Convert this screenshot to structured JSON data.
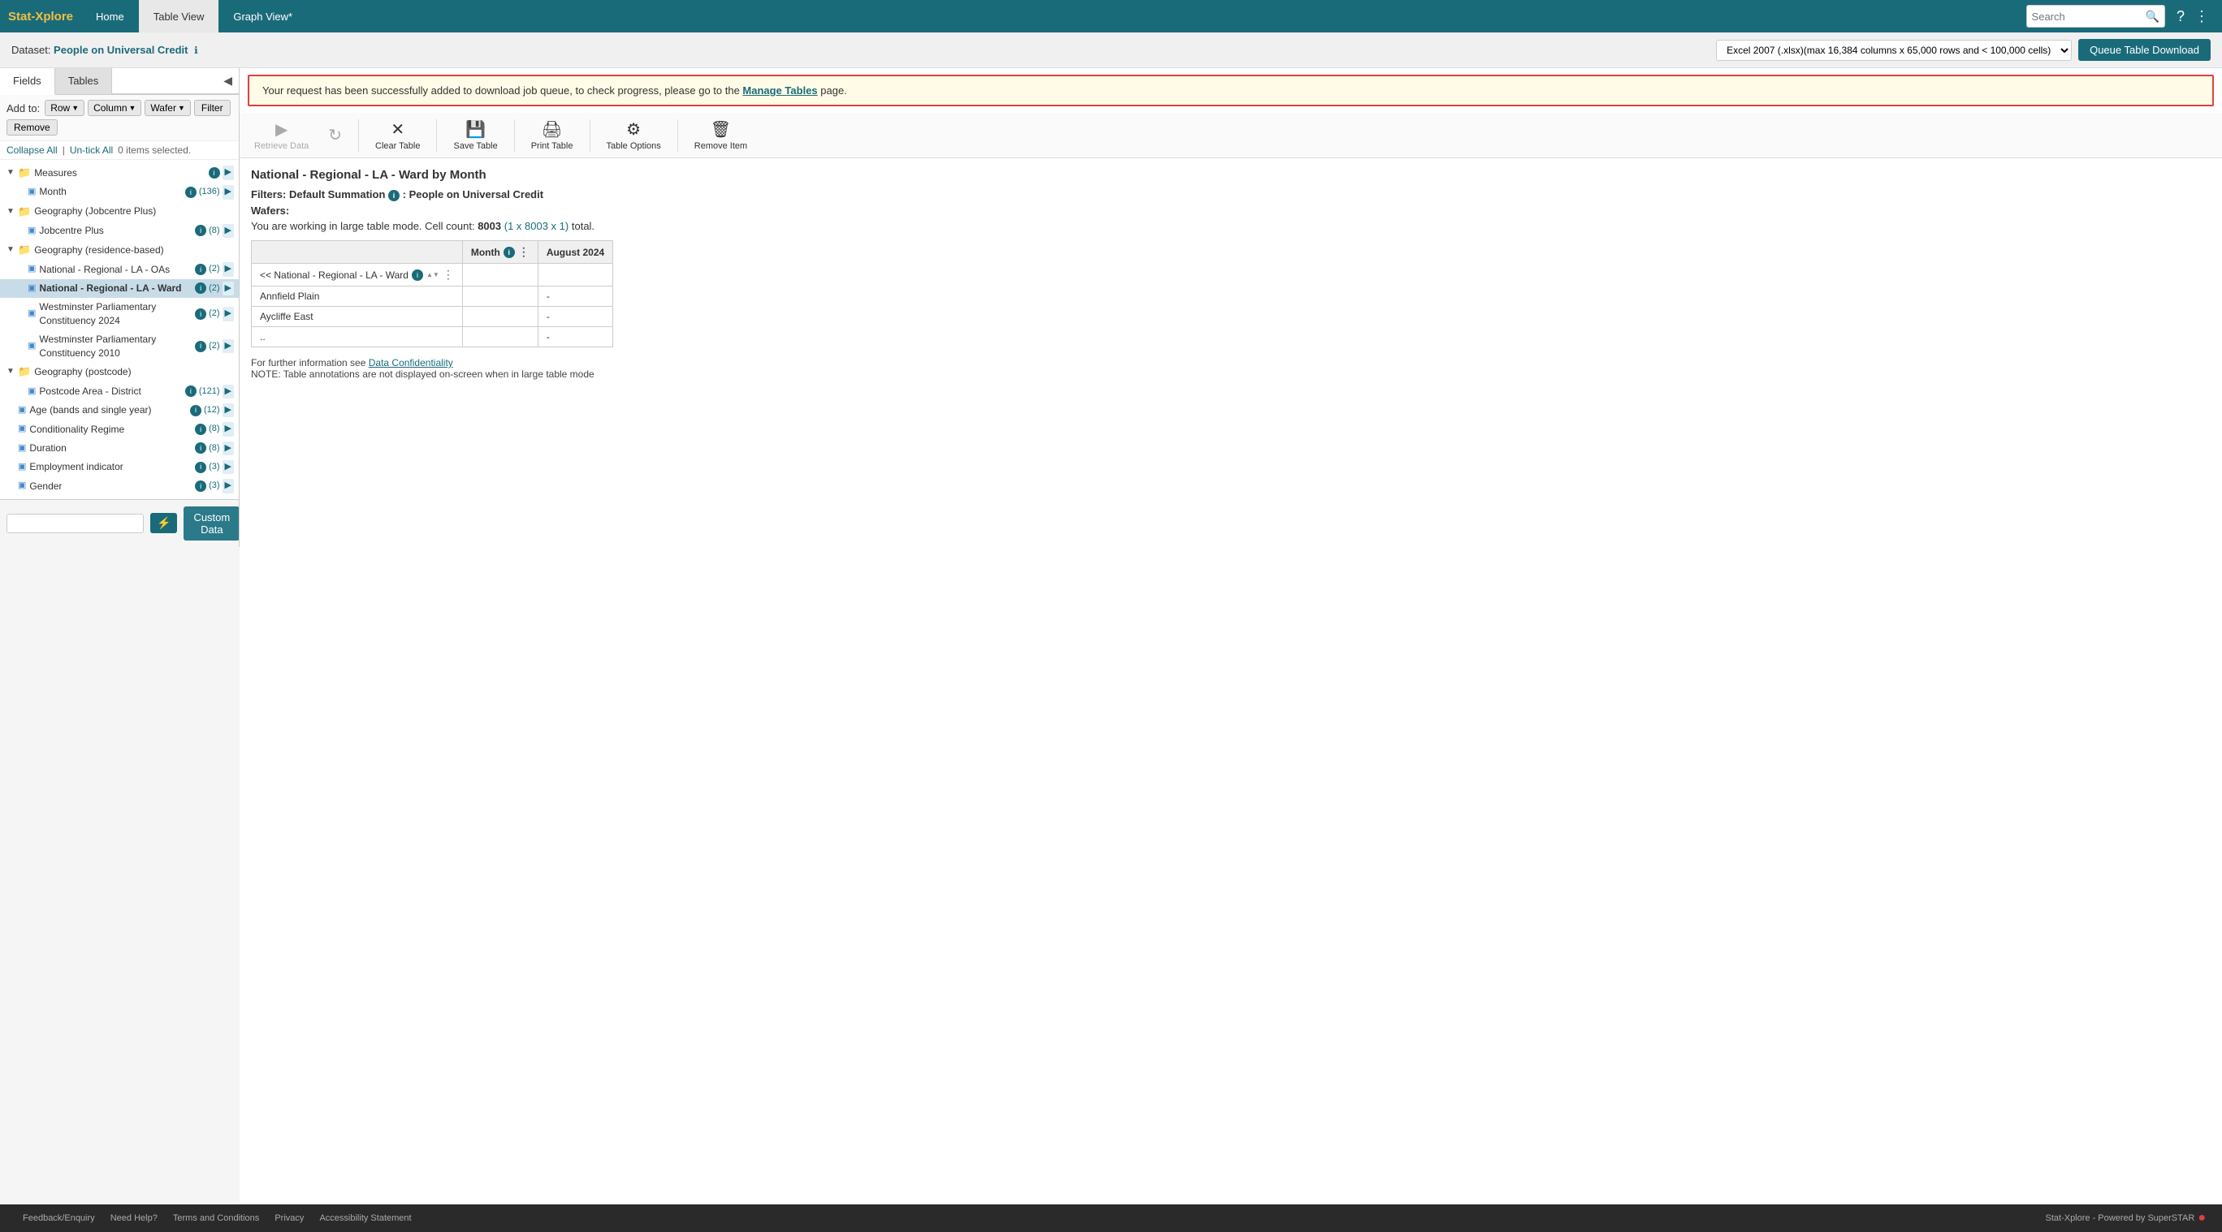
{
  "app": {
    "logo_stat": "Stat",
    "logo_xplore": "-Xplore",
    "nav_home": "Home",
    "nav_table": "Table View",
    "nav_graph": "Graph View*",
    "search_placeholder": "Search",
    "help_icon": "?",
    "menu_icon": "⋮"
  },
  "dataset_bar": {
    "label": "Dataset:",
    "name": "People on Universal Credit",
    "format_options": [
      "Excel 2007 (.xlsx)(max 16,384 columns x 65,000 rows and < 100,000 cells)"
    ],
    "format_selected": "Excel 2007 (.xlsx)(max 16,384 columns x 65,000 rows and < 100,000 cells)",
    "queue_btn": "Queue Table Download"
  },
  "alert": {
    "message_prefix": "Your request has been successfully added to download job queue, to check progress, please go to the ",
    "link_text": "Manage Tables",
    "message_suffix": " page."
  },
  "toolbar": {
    "retrieve_label": "Retrieve Data",
    "clear_label": "Clear Table",
    "save_label": "Save Table",
    "print_label": "Print Table",
    "options_label": "Table Options",
    "remove_label": "Remove Item"
  },
  "sidebar": {
    "tab_fields": "Fields",
    "tab_tables": "Tables",
    "add_to_label": "Add to:",
    "row_btn": "Row",
    "column_btn": "Column",
    "wafer_btn": "Wafer",
    "filter_btn": "Filter",
    "remove_btn": "Remove",
    "collapse_all": "Collapse All",
    "untick_all": "Un-tick All",
    "items_selected": "0 items selected.",
    "tree_items": [
      {
        "level": 0,
        "type": "folder",
        "label": "Measures",
        "expanded": true,
        "has_info": true,
        "has_arrow": true
      },
      {
        "level": 1,
        "type": "item",
        "label": "Month",
        "has_info": true,
        "count": "(136)",
        "has_arrow": true
      },
      {
        "level": 0,
        "type": "folder",
        "label": "Geography (Jobcentre Plus)",
        "expanded": true
      },
      {
        "level": 1,
        "type": "item",
        "label": "Jobcentre Plus",
        "has_info": true,
        "count": "(8)",
        "has_arrow": true
      },
      {
        "level": 0,
        "type": "folder",
        "label": "Geography (residence-based)",
        "expanded": true
      },
      {
        "level": 1,
        "type": "item",
        "label": "National - Regional - LA - OAs",
        "has_info": true,
        "count": "(2)",
        "has_arrow": true,
        "bold": false
      },
      {
        "level": 1,
        "type": "item",
        "label": "National - Regional - LA - Ward",
        "has_info": true,
        "count": "(2)",
        "has_arrow": true,
        "bold": true,
        "selected": true
      },
      {
        "level": 1,
        "type": "item",
        "label": "Westminster Parliamentary Constituency 2024",
        "has_info": true,
        "count": "(2)",
        "has_arrow": true
      },
      {
        "level": 1,
        "type": "item",
        "label": "Westminster Parliamentary Constituency 2010",
        "has_info": true,
        "count": "(2)",
        "has_arrow": true
      },
      {
        "level": 0,
        "type": "folder",
        "label": "Geography (postcode)",
        "expanded": true
      },
      {
        "level": 1,
        "type": "item",
        "label": "Postcode Area - District",
        "has_info": true,
        "count": "(121)",
        "has_arrow": true
      },
      {
        "level": 0,
        "type": "item",
        "label": "Age (bands and single year)",
        "has_info": true,
        "count": "(12)",
        "has_arrow": true
      },
      {
        "level": 0,
        "type": "item",
        "label": "Conditionality Regime",
        "has_info": true,
        "count": "(8)",
        "has_arrow": true
      },
      {
        "level": 0,
        "type": "item",
        "label": "Duration",
        "has_info": true,
        "count": "(8)",
        "has_arrow": true
      },
      {
        "level": 0,
        "type": "item",
        "label": "Employment indicator",
        "has_info": true,
        "count": "(3)",
        "has_arrow": true
      },
      {
        "level": 0,
        "type": "item",
        "label": "Gender",
        "has_info": true,
        "count": "(3)",
        "has_arrow": true
      }
    ],
    "custom_data_btn": "Custom Data"
  },
  "table": {
    "title": "National - Regional - LA - Ward by Month",
    "filters_label": "Filters:",
    "filter_name": "Default Summation",
    "filter_value": "People on Universal Credit",
    "wafers_label": "Wafers:",
    "cell_count_text": "You are working in large table mode. Cell count: ",
    "cell_count": "8003",
    "cell_detail": "(1 x 8003 x 1)",
    "cell_total": "total.",
    "col_header": "Month",
    "col_value": "August 2024",
    "row_header": "<< National - Regional - LA - Ward",
    "rows": [
      {
        "name": "Annfield Plain",
        "value": "-"
      },
      {
        "name": "Aycliffe East",
        "value": "-"
      },
      {
        "name": "..",
        "value": "-"
      }
    ],
    "note1": "For further information see ",
    "note1_link": "Data Confidentiality",
    "note2": "NOTE: Table annotations are not displayed on-screen when in large table mode"
  },
  "footer": {
    "links": [
      "Feedback/Enquiry",
      "Need Help?",
      "Terms and Conditions",
      "Privacy",
      "Accessibility Statement"
    ],
    "brand": "Stat-Xplore - Powered by SuperSTAR"
  }
}
